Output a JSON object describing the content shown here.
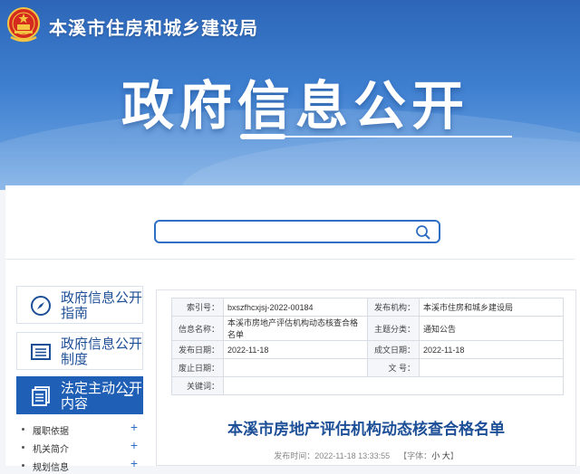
{
  "header": {
    "site_name": "本溪市住房和城乡建设局",
    "hero_title": "政府信息公开"
  },
  "search": {
    "placeholder": ""
  },
  "sidebar": {
    "items": [
      {
        "label": "政府信息公开指南",
        "icon": "compass-icon"
      },
      {
        "label": "政府信息公开制度",
        "icon": "document-list-icon"
      },
      {
        "label": "法定主动公开内容",
        "icon": "documents-icon",
        "active": true,
        "toggle": "−"
      }
    ],
    "subitems": [
      {
        "label": "履职依据",
        "toggle": "+"
      },
      {
        "label": "机关简介",
        "toggle": "+"
      },
      {
        "label": "规划信息",
        "toggle": "+"
      }
    ]
  },
  "meta": {
    "index_label": "索引号：",
    "index_value": "bxszfhcxjsj-2022-00184",
    "publisher_label": "发布机构：",
    "publisher_value": "本溪市住房和城乡建设局",
    "name_label": "信息名称：",
    "name_value": "本溪市房地产评估机构动态核查合格名单",
    "category_label": "主题分类：",
    "category_value": "通知公告",
    "pub_date_label": "发布日期：",
    "pub_date_value": "2022-11-18",
    "created_date_label": "成文日期：",
    "created_date_value": "2022-11-18",
    "repeal_label": "废止日期：",
    "repeal_value": "",
    "docno_label": "文 号：",
    "docno_value": "",
    "keywords_label": "关键词：",
    "keywords_value": ""
  },
  "document": {
    "title": "本溪市房地产评估机构动态核查合格名单",
    "time_text": "发布时间：2022-11-18 13:33:55",
    "font_label": "【字体：",
    "font_small": "小",
    "font_large": "大",
    "font_close": "】"
  },
  "colors": {
    "primary": "#1f5fb6",
    "title": "#1d4f97",
    "border": "#2f6ec4"
  }
}
